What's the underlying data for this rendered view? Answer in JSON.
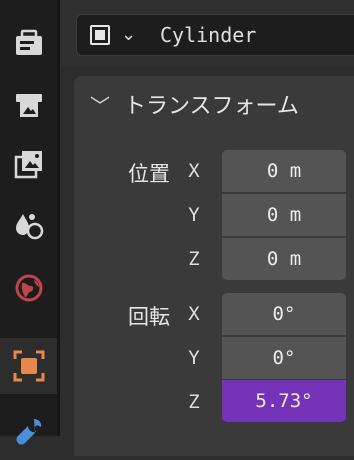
{
  "header": {
    "object_name": "Cylinder"
  },
  "panel": {
    "title": "トランスフォーム",
    "location": {
      "label": "位置",
      "rows": [
        {
          "axis": "X",
          "value": "0 m"
        },
        {
          "axis": "Y",
          "value": "0 m"
        },
        {
          "axis": "Z",
          "value": "0 m"
        }
      ]
    },
    "rotation": {
      "label": "回転",
      "rows": [
        {
          "axis": "X",
          "value": "0°"
        },
        {
          "axis": "Y",
          "value": "0°"
        },
        {
          "axis": "Z",
          "value": "5.73°",
          "selected": true
        }
      ]
    }
  },
  "tabs": [
    {
      "icon": "tool-icon"
    },
    {
      "icon": "render-icon"
    },
    {
      "icon": "output-icon"
    },
    {
      "icon": "view-layer-icon"
    },
    {
      "icon": "world-icon"
    },
    {
      "icon": "object-icon",
      "active": true
    },
    {
      "icon": "modifier-wrench-icon"
    }
  ],
  "colors": {
    "accent_selected": "#7433b8",
    "object_tab_orange": "#e8884a",
    "world_red": "#c0454a"
  }
}
